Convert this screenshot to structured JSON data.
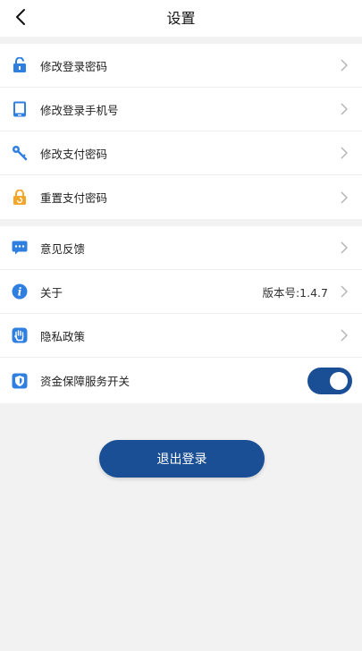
{
  "header": {
    "title": "设置"
  },
  "group1": [
    {
      "label": "修改登录密码",
      "icon": "lock-icon"
    },
    {
      "label": "修改登录手机号",
      "icon": "phone-icon"
    },
    {
      "label": "修改支付密码",
      "icon": "key-icon"
    },
    {
      "label": "重置支付密码",
      "icon": "reset-lock-icon"
    }
  ],
  "group2": [
    {
      "label": "意见反馈",
      "icon": "feedback-icon"
    },
    {
      "label": "关于",
      "icon": "info-icon",
      "value": "版本号:1.4.7"
    },
    {
      "label": "隐私政策",
      "icon": "hand-icon"
    },
    {
      "label": "资金保障服务开关",
      "icon": "shield-icon",
      "toggle_on": true
    }
  ],
  "logout_label": "退出登录",
  "colors": {
    "primary": "#1a4f96",
    "icon_blue": "#2f7fe0",
    "icon_orange": "#f4a62a"
  }
}
